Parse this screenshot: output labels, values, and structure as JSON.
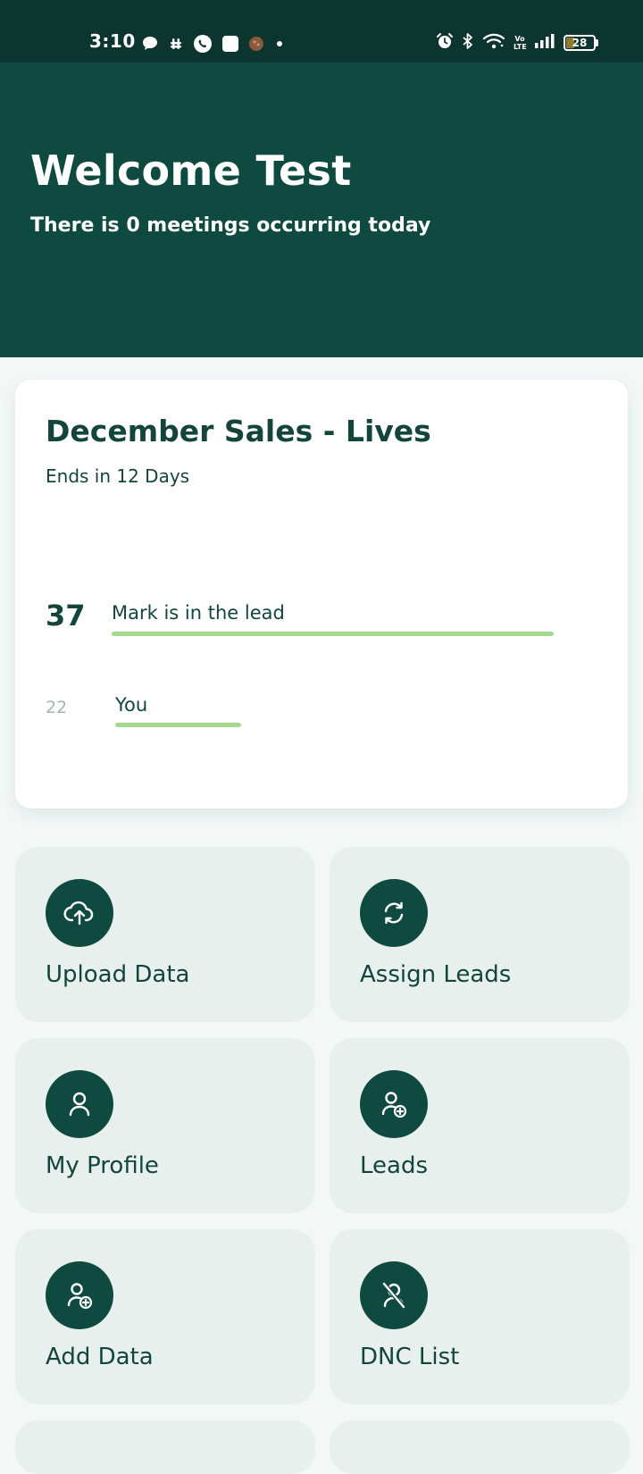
{
  "status_bar": {
    "time": "3:10",
    "battery_level": "28",
    "icons_left": [
      "chat-bubble-icon",
      "slack-icon",
      "whatsapp-icon",
      "square-app-icon",
      "avatar-icon",
      "dot-icon"
    ],
    "icons_right": [
      "alarm-icon",
      "bluetooth-icon",
      "wifi-icon",
      "volte-icon",
      "signal-icon",
      "battery-icon"
    ],
    "volte_text": "Vo LTE"
  },
  "header": {
    "title": "Welcome Test",
    "subtitle": "There is 0 meetings occurring today",
    "background": "#0f4a40"
  },
  "sales_card": {
    "title": "December Sales - Lives",
    "subtitle": "Ends in 12 Days",
    "entries": [
      {
        "score": "37",
        "label": "Mark is in the lead",
        "progress": 1.0
      },
      {
        "score": "22",
        "label": "You",
        "progress": 0.285
      }
    ],
    "bar_color": "#a4d98c"
  },
  "tiles": [
    {
      "label": "Upload Data",
      "icon": "cloud-upload-icon"
    },
    {
      "label": "Assign Leads",
      "icon": "refresh-icon"
    },
    {
      "label": "My Profile",
      "icon": "user-icon"
    },
    {
      "label": "Leads",
      "icon": "user-add-icon"
    },
    {
      "label": "Add Data",
      "icon": "user-add-icon"
    },
    {
      "label": "DNC List",
      "icon": "user-blocked-icon"
    }
  ],
  "colors": {
    "primary": "#0f4a40",
    "tile_bg": "#e8f0ee",
    "page_bg": "#f3f8f7"
  }
}
